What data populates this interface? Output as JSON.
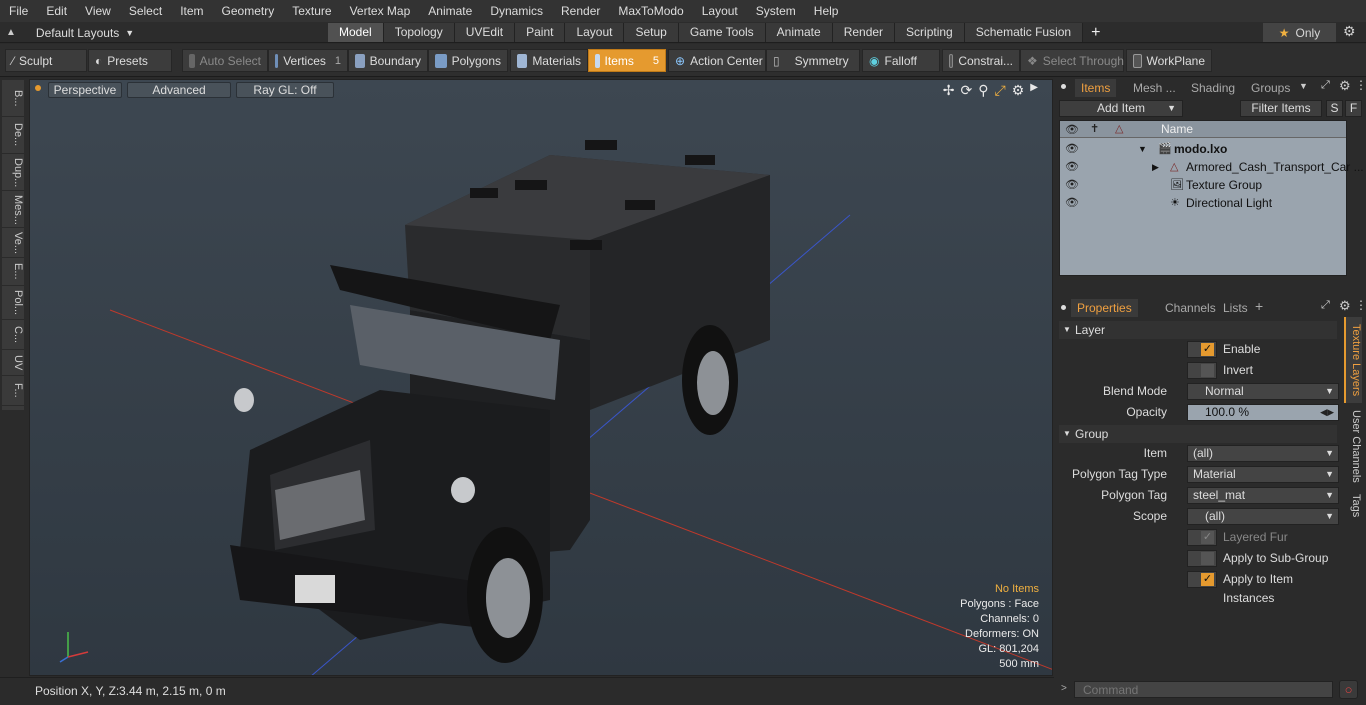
{
  "menu": [
    "File",
    "Edit",
    "View",
    "Select",
    "Item",
    "Geometry",
    "Texture",
    "Vertex Map",
    "Animate",
    "Dynamics",
    "Render",
    "MaxToModo",
    "Layout",
    "System",
    "Help"
  ],
  "layout_selector": "Default Layouts",
  "tabs": [
    "Model",
    "Topology",
    "UVEdit",
    "Paint",
    "Layout",
    "Setup",
    "Game Tools",
    "Animate",
    "Render",
    "Scripting",
    "Schematic Fusion"
  ],
  "active_tab": "Model",
  "only_label": "Only",
  "toolbar": {
    "sculpt": "Sculpt",
    "presets": "Presets",
    "auto_select": "Auto Select",
    "vertices": "Vertices",
    "vertices_count": "1",
    "boundary": "Boundary",
    "polygons": "Polygons",
    "materials": "Materials",
    "items": "Items",
    "items_count": "5",
    "action_center": "Action Center",
    "symmetry": "Symmetry",
    "falloff": "Falloff",
    "constraints": "Constrai...",
    "select_through": "Select Through",
    "workplane": "WorkPlane"
  },
  "left_tabs": [
    "B...",
    "De...",
    "Dup...",
    "Mes...",
    "Ve...",
    "E...",
    "Pol...",
    "C...",
    "UV",
    "F..."
  ],
  "viewport": {
    "perspective": "Perspective",
    "advanced": "Advanced",
    "raygl": "Ray GL: Off",
    "info": {
      "no_items": "No Items",
      "polygons": "Polygons : Face",
      "channels": "Channels: 0",
      "deformers": "Deformers: ON",
      "gl": "GL: 801,204",
      "scale": "500 mm"
    }
  },
  "status": {
    "position_label": "Position X, Y, Z:",
    "position_value": "3.44 m, 2.15 m, 0 m"
  },
  "items_panel": {
    "tabs": [
      "Items",
      "Mesh ...",
      "Shading",
      "Groups"
    ],
    "add_item": "Add Item",
    "filter_items": "Filter Items",
    "s": "S",
    "f": "F",
    "name_header": "Name",
    "rows": [
      "modo.lxo",
      "Armored_Cash_Transport_Car ...",
      "Texture Group",
      "Directional Light"
    ]
  },
  "properties_panel": {
    "tabs": [
      "Properties",
      "Channels",
      "Lists"
    ],
    "layer_section": "Layer",
    "enable": "Enable",
    "invert": "Invert",
    "blend_mode_label": "Blend Mode",
    "blend_mode": "Normal",
    "opacity_label": "Opacity",
    "opacity": "100.0 %",
    "group_section": "Group",
    "item_label": "Item",
    "item_value": "(all)",
    "ptype_label": "Polygon Tag Type",
    "ptype_value": "Material",
    "ptag_label": "Polygon Tag",
    "ptag_value": "steel_mat",
    "scope_label": "Scope",
    "scope_value": "(all)",
    "layered_fur": "Layered Fur",
    "apply_subgroup": "Apply to Sub-Group",
    "apply_instances": "Apply to Item Instances",
    "side_tabs": [
      "Texture Layers",
      "User Channels",
      "Tags"
    ]
  },
  "command_placeholder": "Command",
  "colors": {
    "accent": "#e59a2f",
    "viewport_bg": "#36404a"
  }
}
